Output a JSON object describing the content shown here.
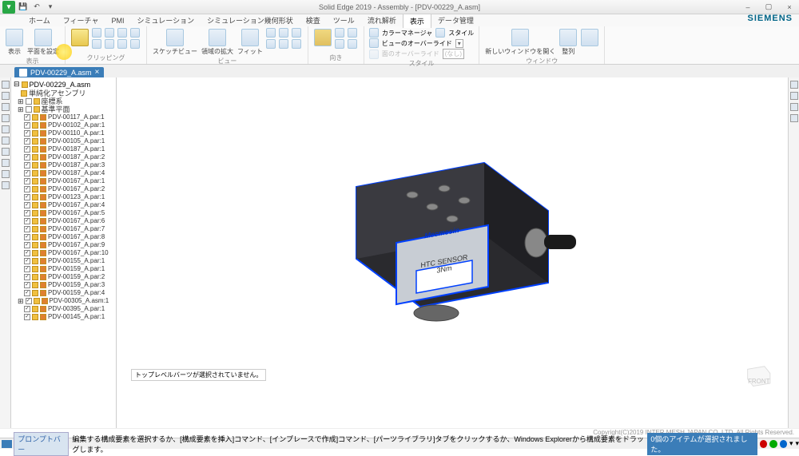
{
  "title": "Solid Edge 2019 - Assembly - [PDV-00229_A.asm]",
  "brand": "SIEMENS",
  "qat": {
    "undo": "↶",
    "redo": "↷"
  },
  "tabs": [
    "ホーム",
    "フィーチャ",
    "PMI",
    "シミュレーション",
    "シミュレーション幾何形状",
    "検査",
    "ツール",
    "流れ解析",
    "表示",
    "データ管理"
  ],
  "active_tab": "表示",
  "ribbon": {
    "g1": {
      "btn1": "表示",
      "btn2": "平面を設定",
      "label": "表示"
    },
    "g2": {
      "label": "クリッピング"
    },
    "g3": {
      "b1": "スケッチビュー",
      "b2": "領域の拡大",
      "b3": "フィット",
      "label": "ビュー"
    },
    "g4": {
      "label": "向き"
    },
    "g5": {
      "cm": "カラーマネージャ",
      "st": "スタイル",
      "vol": "ビューのオーバーライド",
      "ovr": "面のオーバーライド",
      "none": "(なし)",
      "label": "スタイル"
    },
    "g6": {
      "b1": "新しいウィンドウを開く",
      "b2": "整列",
      "label": "ウィンドウ"
    }
  },
  "doctab": "PDV-00229_A.asm",
  "tree_root": "PDV-00229_A.asm",
  "tree_sub1": "単純化アセンブリ",
  "tree_sub2": "座標系",
  "tree_sub3": "基準平面",
  "tree_items": [
    "PDV-00117_A.par:1",
    "PDV-00102_A.par:1",
    "PDV-00110_A.par:1",
    "PDV-00105_A.par:1",
    "PDV-00187_A.par:1",
    "PDV-00187_A.par:2",
    "PDV-00187_A.par:3",
    "PDV-00187_A.par:4",
    "PDV-00167_A.par:1",
    "PDV-00167_A.par:2",
    "PDV-00123_A.par:1",
    "PDV-00167_A.par:4",
    "PDV-00167_A.par:5",
    "PDV-00167_A.par:6",
    "PDV-00167_A.par:7",
    "PDV-00167_A.par:8",
    "PDV-00167_A.par:9",
    "PDV-00167_A.par:10",
    "PDV-00155_A.par:1",
    "PDV-00159_A.par:1",
    "PDV-00159_A.par:2",
    "PDV-00159_A.par:3",
    "PDV-00159_A.par:4",
    "PDV-00305_A.asm:1",
    "PDV-00395_A.par:1",
    "PDV-00145_A.par:1"
  ],
  "product": {
    "brand": "Mecmesin",
    "label1": "HTC SENSOR",
    "label2": "3Nm"
  },
  "bottom_msg": "トップレベルバーツが選択されていません。",
  "compass_lbl": "FRONT",
  "copyright": "Copyright(C)2019 INTER MESH JAPAN CO.,LTD. All Rights Reserved.",
  "prompt": "プロンプトバー",
  "prompt_msg": "編集する構成要素を選択するか、[構成要素を挿入]コマンド、[インプレースで作成]コマンド、[パーツライブラリ]タブをクリックするか、Windows Explorerから構成要素をドラッグします。",
  "status": "0個のアイテムが選択されました。"
}
